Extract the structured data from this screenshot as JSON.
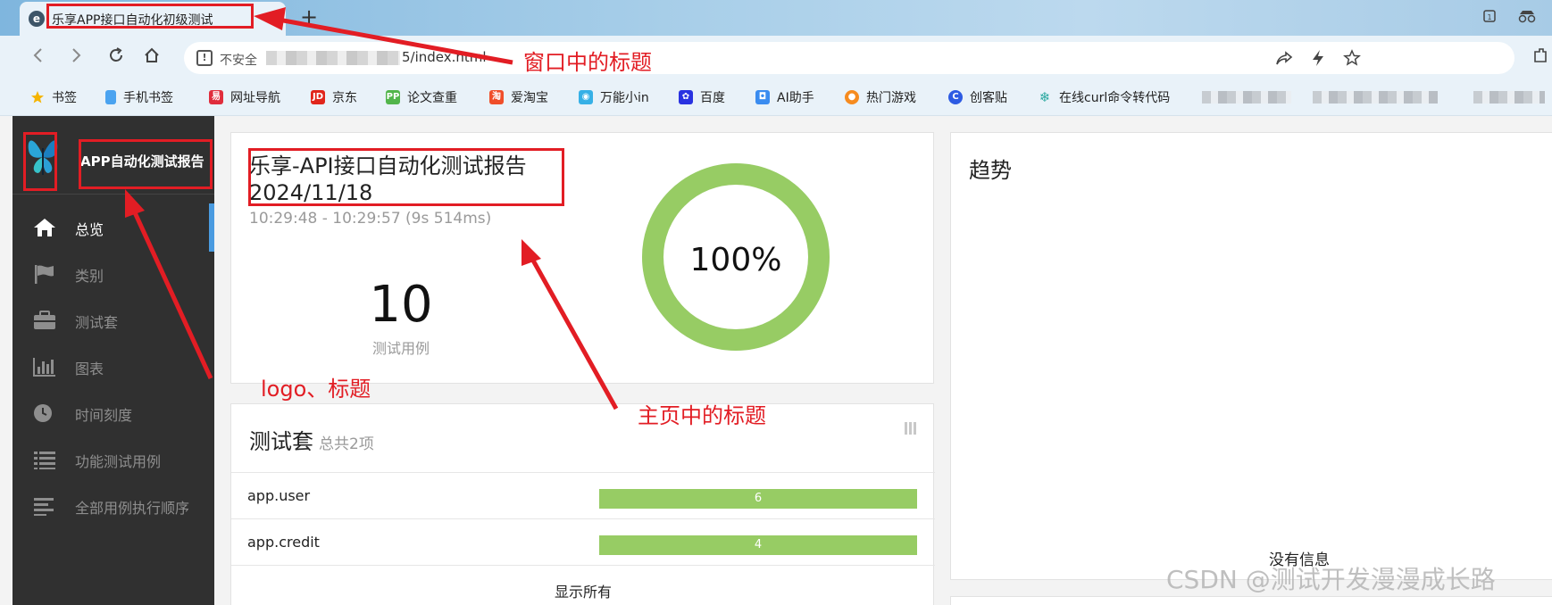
{
  "browser": {
    "tab_title": "乐享APP接口自动化初级测试",
    "tab_close": "×",
    "new_tab": "+",
    "insecure_label": "不安全",
    "url_tail": "5/index.html",
    "bookmarks": [
      {
        "label": "书签",
        "icon": "star-icon",
        "color": "#f5b400"
      },
      {
        "label": "手机书签",
        "icon": "phone-icon",
        "color": "#4aa3f0"
      },
      {
        "label": "网址导航",
        "icon": "navigation-icon",
        "color": "#e02d3c"
      },
      {
        "label": "京东",
        "icon": "jd-icon",
        "color": "#e1251b"
      },
      {
        "label": "论文查重",
        "icon": "pp-icon",
        "color": "#52b54b"
      },
      {
        "label": "爱淘宝",
        "icon": "taobao-icon",
        "color": "#f04e2a"
      },
      {
        "label": "万能小in",
        "icon": "robot-icon",
        "color": "#36b0e6"
      },
      {
        "label": "百度",
        "icon": "baidu-icon",
        "color": "#2932e1"
      },
      {
        "label": "AI助手",
        "icon": "ai-icon",
        "color": "#3a8cf0"
      },
      {
        "label": "热门游戏",
        "icon": "game-icon",
        "color": "#f68b1f"
      },
      {
        "label": "创客贴",
        "icon": "chuangketie-icon",
        "color": "#2d5be3"
      },
      {
        "label": "在线curl命令转代码",
        "icon": "curl-icon",
        "color": "#2aa8a0"
      }
    ]
  },
  "sidebar": {
    "app_title": "APP自动化测试报告",
    "items": [
      {
        "label": "总览",
        "icon": "home-icon",
        "active": true
      },
      {
        "label": "类别",
        "icon": "flag-icon",
        "active": false
      },
      {
        "label": "测试套",
        "icon": "briefcase-icon",
        "active": false
      },
      {
        "label": "图表",
        "icon": "bar-chart-icon",
        "active": false
      },
      {
        "label": "时间刻度",
        "icon": "clock-icon",
        "active": false
      },
      {
        "label": "功能测试用例",
        "icon": "list-icon",
        "active": false
      },
      {
        "label": "全部用例执行顺序",
        "icon": "align-left-icon",
        "active": false
      }
    ]
  },
  "overview": {
    "title_line1": "乐享-API接口自动化测试报告",
    "title_line2": "2024/11/18",
    "time_range": "10:29:48 - 10:29:57 (9s 514ms)",
    "total_cases": "10",
    "total_label": "测试用例",
    "pass_rate": "100%",
    "pass_fraction": 1.0,
    "ring_color": "#97cc64"
  },
  "suites": {
    "title": "测试套",
    "count_label": "总共2项",
    "rows": [
      {
        "name": "app.user",
        "count": "6"
      },
      {
        "name": "app.credit",
        "count": "4"
      }
    ],
    "show_all": "显示所有"
  },
  "trend": {
    "title": "趋势",
    "empty": "没有信息"
  },
  "annotations": {
    "window_title": "窗口中的标题",
    "logo_title": "logo、标题",
    "home_title": "主页中的标题",
    "color": "#e21d24"
  },
  "watermark": "CSDN @测试开发漫漫成长路"
}
